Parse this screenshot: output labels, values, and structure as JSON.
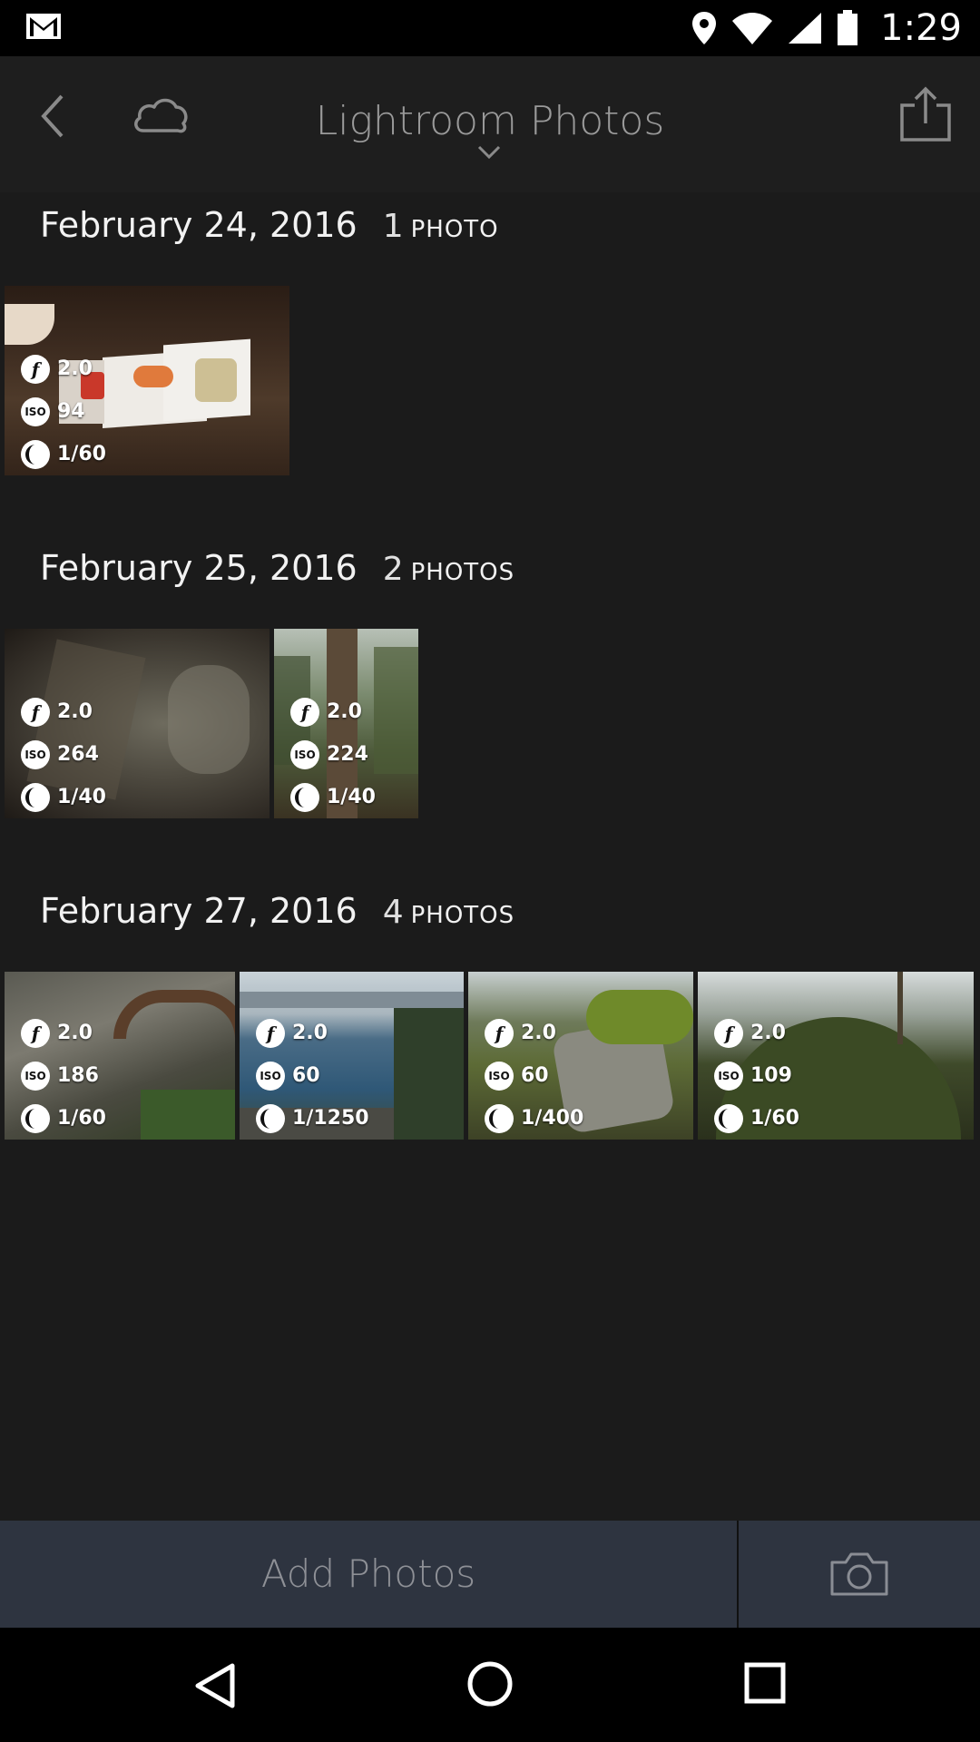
{
  "status_bar": {
    "time": "1:29"
  },
  "app_bar": {
    "title": "Lightroom Photos"
  },
  "groups": [
    {
      "date": "February 24, 2016",
      "count": "1",
      "unit": "PHOTO",
      "photos": [
        {
          "aperture": "2.0",
          "iso": "94",
          "shutter": "1/60"
        }
      ]
    },
    {
      "date": "February 25, 2016",
      "count": "2",
      "unit": "PHOTOS",
      "photos": [
        {
          "aperture": "2.0",
          "iso": "264",
          "shutter": "1/40"
        },
        {
          "aperture": "2.0",
          "iso": "224",
          "shutter": "1/40"
        }
      ]
    },
    {
      "date": "February 27, 2016",
      "count": "4",
      "unit": "PHOTOS",
      "photos": [
        {
          "aperture": "2.0",
          "iso": "186",
          "shutter": "1/60"
        },
        {
          "aperture": "2.0",
          "iso": "60",
          "shutter": "1/1250"
        },
        {
          "aperture": "2.0",
          "iso": "60",
          "shutter": "1/400"
        },
        {
          "aperture": "2.0",
          "iso": "109",
          "shutter": "1/60"
        }
      ]
    }
  ],
  "meta_icons": {
    "aperture": "f",
    "iso": "ISO"
  },
  "bottom_bar": {
    "add_photos_label": "Add Photos"
  },
  "colors": {
    "background": "#1b1b1b",
    "bottom_bar": "#2e3440",
    "title": "#9a9a9a"
  }
}
